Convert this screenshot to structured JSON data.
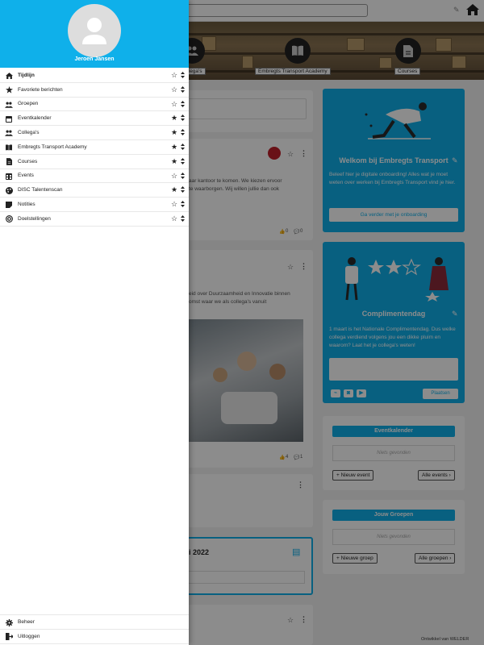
{
  "user": {
    "name": "Jeroen Jansen"
  },
  "menu": {
    "items": [
      {
        "label": "Tijdlijn",
        "icon": "home-icon",
        "favorite": false,
        "active": true
      },
      {
        "label": "Favoriete berichten",
        "icon": "star-icon",
        "favorite": false,
        "active": false
      },
      {
        "label": "Groepen",
        "icon": "users-icon",
        "favorite": false,
        "active": false
      },
      {
        "label": "Eventkalender",
        "icon": "calendar-icon",
        "favorite": true,
        "active": false
      },
      {
        "label": "Collega's",
        "icon": "users-icon",
        "favorite": true,
        "active": false
      },
      {
        "label": "Embregts Transport Academy",
        "icon": "book-icon",
        "favorite": true,
        "active": false
      },
      {
        "label": "Courses",
        "icon": "file-icon",
        "favorite": true,
        "active": false
      },
      {
        "label": "Events",
        "icon": "calendar-grid-icon",
        "favorite": false,
        "active": false
      },
      {
        "label": "DISC Talentenscan",
        "icon": "palette-icon",
        "favorite": true,
        "active": false
      },
      {
        "label": "Notities",
        "icon": "note-icon",
        "favorite": false,
        "active": false
      },
      {
        "label": "Doelstellingen",
        "icon": "target-icon",
        "favorite": false,
        "active": false
      }
    ],
    "bottom": [
      {
        "label": "Beheer",
        "icon": "gear-icon"
      },
      {
        "label": "Uitloggen",
        "icon": "logout-icon"
      }
    ]
  },
  "banner": {
    "tiles": [
      {
        "label": "Collega's"
      },
      {
        "label": "Embregts Transport Academy"
      },
      {
        "label": "Courses"
      }
    ]
  },
  "feed": {
    "post1": {
      "text_line1": "aar kantoor te komen. We kiezen ervoor",
      "text_line2": "te waarborgen. Wij willen jullie dan ook",
      "likes": "0",
      "comments": "0"
    },
    "post2": {
      "text_line1": "eid over Duurzaamheid en Innovatie binnen",
      "text_line2": "omst waar we als collega's vanuit",
      "likes": "4",
      "comments": "1"
    },
    "event_card": {
      "title": "i 2022"
    }
  },
  "welcome_card": {
    "title": "Welkom bij Embregts Transport",
    "text": "Beleef hier je digitale onboarding! Alles wat je moet weten over werken bij Embregts Transport vind je hier.",
    "button": "Ga verder met je onboarding"
  },
  "compliment_card": {
    "title": "Complimentendag",
    "text": "1 maart is het Nationale Complimentendag. Dus welke collega verdiend volgens jou een dikke pluim en waarom? Laat het je collega's weten!",
    "post_button": "Plaatsen"
  },
  "eventkalender": {
    "title": "Eventkalender",
    "empty": "Niets gevonden",
    "new_button": "Nieuw event",
    "all_button": "Alle events"
  },
  "groups": {
    "title": "Jouw Groepen",
    "empty": "Niets gevonden",
    "new_button": "Nieuwe groep",
    "all_button": "Alle groepen"
  },
  "footer": {
    "credit": "Ontwikkel van WELDER"
  },
  "colors": {
    "accent": "#0fb0ea",
    "overlay": "rgba(0,0,0,0.45)"
  }
}
